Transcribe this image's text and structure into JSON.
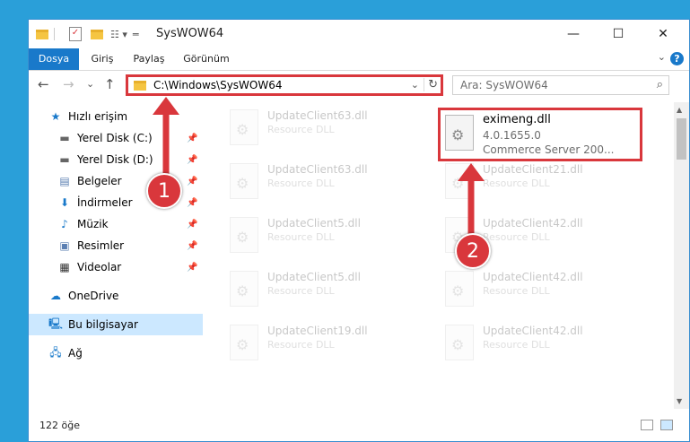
{
  "window": {
    "title": "SysWOW64",
    "minimize": "—",
    "maximize": "☐",
    "close": "✕"
  },
  "ribbon": {
    "tabs": [
      {
        "label": "Dosya"
      },
      {
        "label": "Giriş"
      },
      {
        "label": "Paylaş"
      },
      {
        "label": "Görünüm"
      }
    ],
    "help": "?"
  },
  "nav": {
    "back": "←",
    "forward": "→",
    "recent": "⌄",
    "up": "↑",
    "address": "C:\\Windows\\SysWOW64",
    "refresh": "↻",
    "search_placeholder": "Ara: SysWOW64"
  },
  "sidebar": {
    "items": [
      {
        "label": "Hızlı erişim",
        "icon": "star-icon"
      },
      {
        "label": "Yerel Disk (C:)",
        "icon": "drive-icon"
      },
      {
        "label": "Yerel Disk (D:)",
        "icon": "drive-icon"
      },
      {
        "label": "Belgeler",
        "icon": "documents-icon"
      },
      {
        "label": "İndirmeler",
        "icon": "download-icon"
      },
      {
        "label": "Müzik",
        "icon": "music-icon"
      },
      {
        "label": "Resimler",
        "icon": "pictures-icon"
      },
      {
        "label": "Videolar",
        "icon": "videos-icon"
      },
      {
        "label": "OneDrive",
        "icon": "cloud-icon"
      },
      {
        "label": "Bu bilgisayar",
        "icon": "computer-icon"
      },
      {
        "label": "Ağ",
        "icon": "network-icon"
      }
    ]
  },
  "files": {
    "left": [
      {
        "name": "UpdateClient63.dll",
        "sub": "Resource DLL"
      },
      {
        "name": "UpdateClient63.dll",
        "sub": "Resource DLL"
      },
      {
        "name": "UpdateClient5.dll",
        "sub": "Resource DLL"
      },
      {
        "name": "UpdateClient5.dll",
        "sub": "Resource DLL"
      },
      {
        "name": "UpdateClient19.dll",
        "sub": "Resource DLL"
      }
    ],
    "highlighted": {
      "name": "eximeng.dll",
      "version": "4.0.1655.0",
      "desc": "Commerce Server 200..."
    },
    "right": [
      {
        "name": "UpdateClient21.dll",
        "sub": "Resource DLL"
      },
      {
        "name": "UpdateClient42.dll",
        "sub": "Resource DLL"
      },
      {
        "name": "UpdateClient42.dll",
        "sub": "Resource DLL"
      },
      {
        "name": "UpdateClient42.dll",
        "sub": "Resource DLL"
      }
    ]
  },
  "status": {
    "count": "122 öğe"
  },
  "annotations": {
    "step1": "1",
    "step2": "2"
  },
  "colors": {
    "accent": "#1979ca",
    "highlight": "#d9373c",
    "selected": "#cce8ff"
  }
}
